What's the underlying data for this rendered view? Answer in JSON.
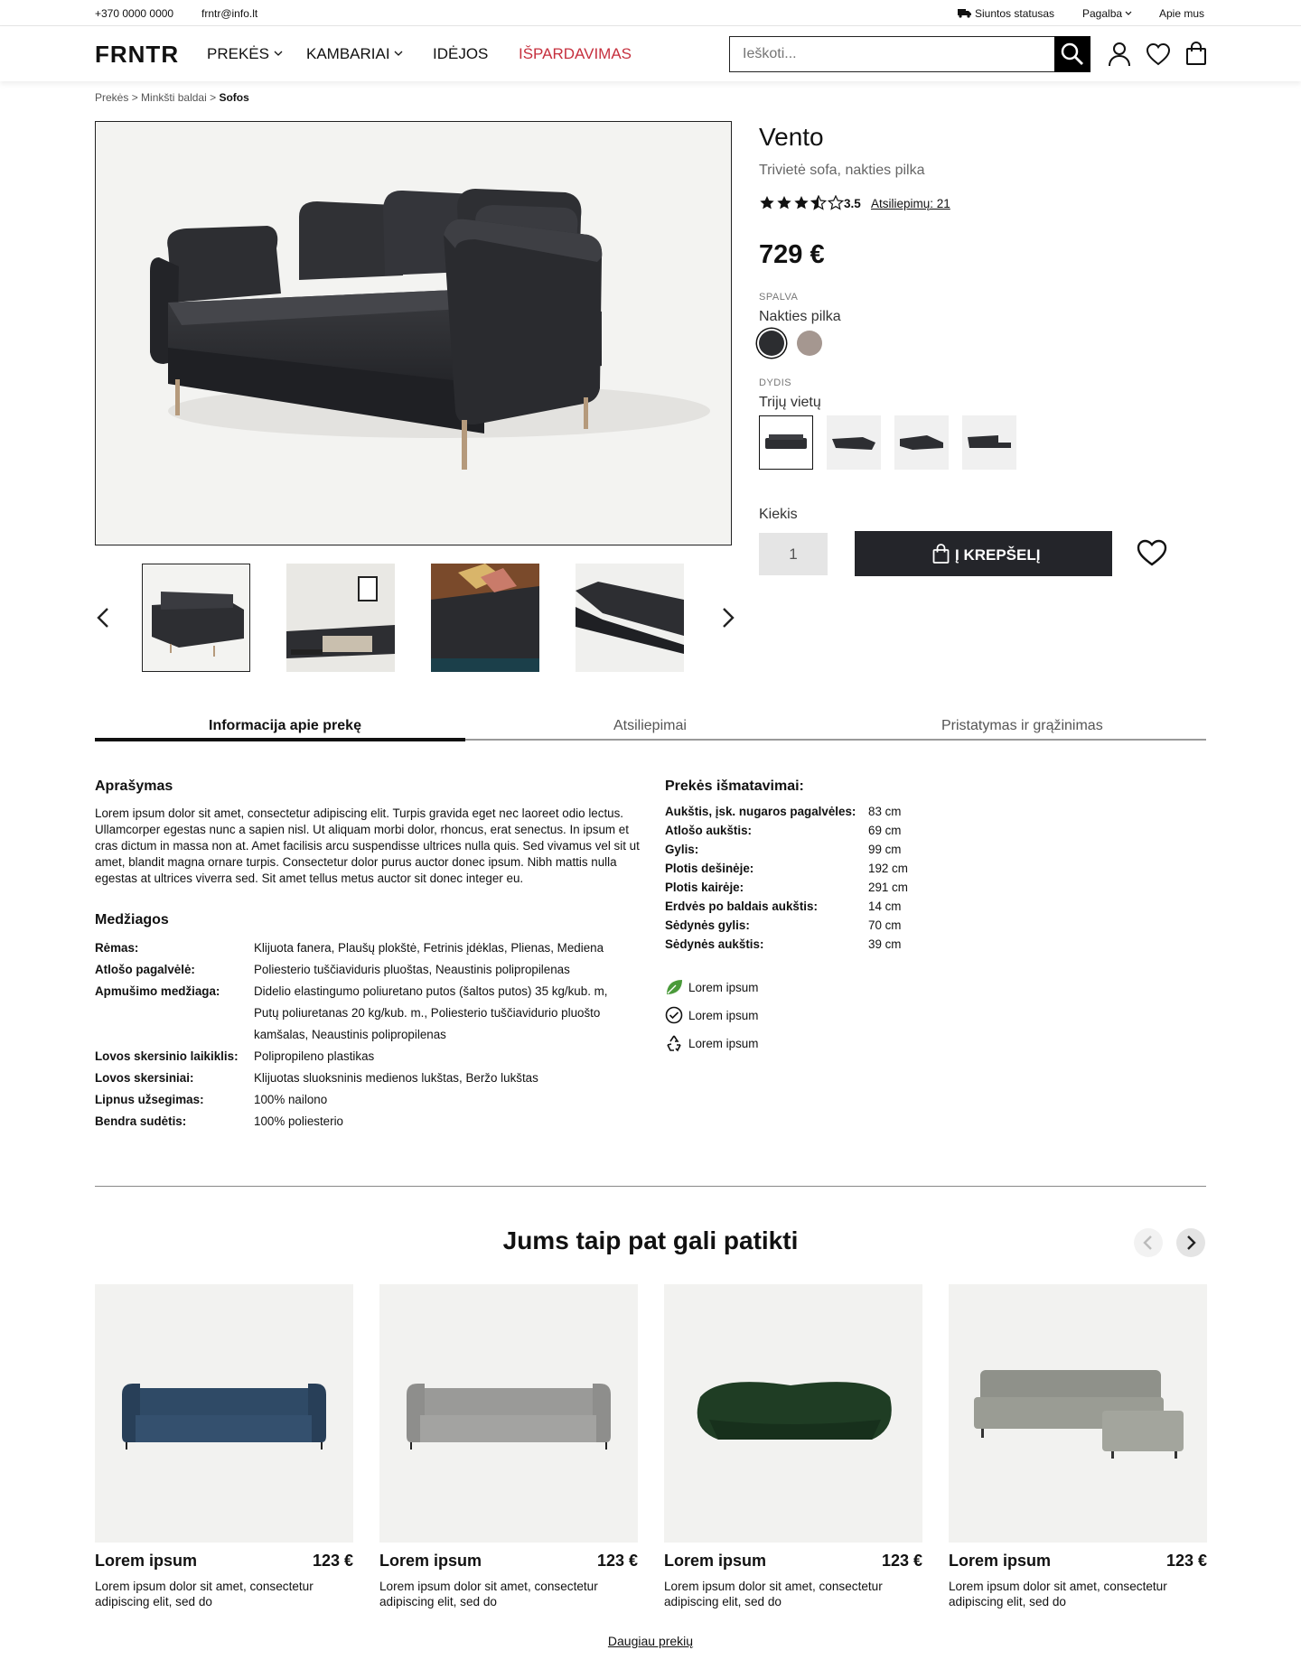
{
  "topbar": {
    "phone": "+370 0000 0000",
    "email": "frntr@info.lt",
    "shipping_status": "Siuntos statusas",
    "help": "Pagalba",
    "about": "Apie mus"
  },
  "header": {
    "logo": "FRNTR",
    "nav": [
      "PREKĖS",
      "KAMBARIAI",
      "IDĖJOS",
      "IŠPARDAVIMAS"
    ],
    "search_placeholder": "Ieškoti...",
    "accent_color": "#c6303e"
  },
  "breadcrumb": [
    "Prekės",
    "Minkšti baldai",
    "Sofos"
  ],
  "product": {
    "name": "Vento",
    "subtitle": "Trivietė sofa, nakties pilka",
    "rating": "3.5",
    "reviews_link": "Atsiliepimų: 21",
    "price": "729 €",
    "color_label": "SPALVA",
    "color_value": "Nakties pilka",
    "colors": [
      "#2c2d30",
      "#a59790"
    ],
    "size_label": "DYDIS",
    "size_value": "Trijų vietų",
    "quantity_label": "Kiekis",
    "quantity": "1",
    "add_to_cart": "Į KREPŠELĮ"
  },
  "tabs": [
    "Informacija apie prekę",
    "Atsiliepimai",
    "Pristatymas ir grąžinimas"
  ],
  "description": {
    "heading": "Aprašymas",
    "text": "Lorem ipsum dolor sit amet, consectetur adipiscing elit. Turpis gravida eget nec laoreet odio lectus. Ullamcorper egestas nunc a sapien nisl. Ut aliquam morbi dolor, rhoncus, erat senectus. In ipsum et cras dictum in massa non at. Amet facilisis arcu suspendisse ultrices nulla quis. Sed vivamus vel sit ut amet, blandit magna ornare turpis. Consectetur dolor purus auctor donec ipsum. Nibh mattis nulla egestas at ultrices viverra sed. Sit amet tellus metus auctor sit donec integer eu."
  },
  "materials": {
    "heading": "Medžiagos",
    "rows": [
      {
        "k": "Rėmas:",
        "v": [
          "Klijuota fanera, Plaušų plokštė, Fetrinis įdėklas, Plienas, Mediena"
        ]
      },
      {
        "k": "Atlošo pagalvėlė:",
        "v": [
          "Poliesterio tuščiaviduris pluoštas, Neaustinis polipropilenas"
        ]
      },
      {
        "k": "Apmušimo medžiaga:",
        "v": [
          "Didelio elastingumo poliuretano putos (šaltos putos) 35 kg/kub. m,",
          "Putų poliuretanas 20 kg/kub. m., Poliesterio tuščiavidurio pluošto",
          "kamšalas, Neaustinis polipropilenas"
        ]
      },
      {
        "k": "Lovos skersinio laikiklis:",
        "v": [
          "Polipropileno plastikas"
        ]
      },
      {
        "k": "Lovos skersiniai:",
        "v": [
          "Klijuotas sluoksninis medienos lukštas, Beržo lukštas"
        ]
      },
      {
        "k": "Lipnus užsegimas:",
        "v": [
          "100% nailono"
        ]
      },
      {
        "k": "Bendra sudėtis:",
        "v": [
          "100% poliesterio"
        ]
      }
    ]
  },
  "dimensions": {
    "heading": "Prekės išmatavimai:",
    "rows": [
      {
        "k": "Aukštis, įsk. nugaros pagalvėles:",
        "v": "83 cm"
      },
      {
        "k": "Atlošo aukštis:",
        "v": "69 cm"
      },
      {
        "k": "Gylis:",
        "v": "99 cm"
      },
      {
        "k": "Plotis dešinėje:",
        "v": "192 cm"
      },
      {
        "k": "Plotis kairėje:",
        "v": "291 cm"
      },
      {
        "k": "Erdvės po baldais aukštis:",
        "v": "14 cm"
      },
      {
        "k": "Sėdynės gylis:",
        "v": "70 cm"
      },
      {
        "k": "Sėdynės aukštis:",
        "v": "39 cm"
      }
    ]
  },
  "features": [
    "Lorem ipsum",
    "Lorem ipsum",
    "Lorem ipsum"
  ],
  "recommendations": {
    "title": "Jums taip pat gali patikti",
    "items": [
      {
        "name": "Lorem ipsum",
        "price": "123 €",
        "desc": "Lorem ipsum dolor sit amet, consectetur adipiscing elit, sed do",
        "color": "#2f4a66"
      },
      {
        "name": "Lorem ipsum",
        "price": "123 €",
        "desc": "Lorem ipsum dolor sit amet, consectetur adipiscing elit, sed do",
        "color": "#9a9a98"
      },
      {
        "name": "Lorem ipsum",
        "price": "123 €",
        "desc": "Lorem ipsum dolor sit amet, consectetur adipiscing elit, sed do",
        "color": "#1f3d24"
      },
      {
        "name": "Lorem ipsum",
        "price": "123 €",
        "desc": "Lorem ipsum dolor sit amet, consectetur adipiscing elit, sed do",
        "color": "#9a9c94"
      }
    ],
    "more": "Daugiau prekių"
  }
}
